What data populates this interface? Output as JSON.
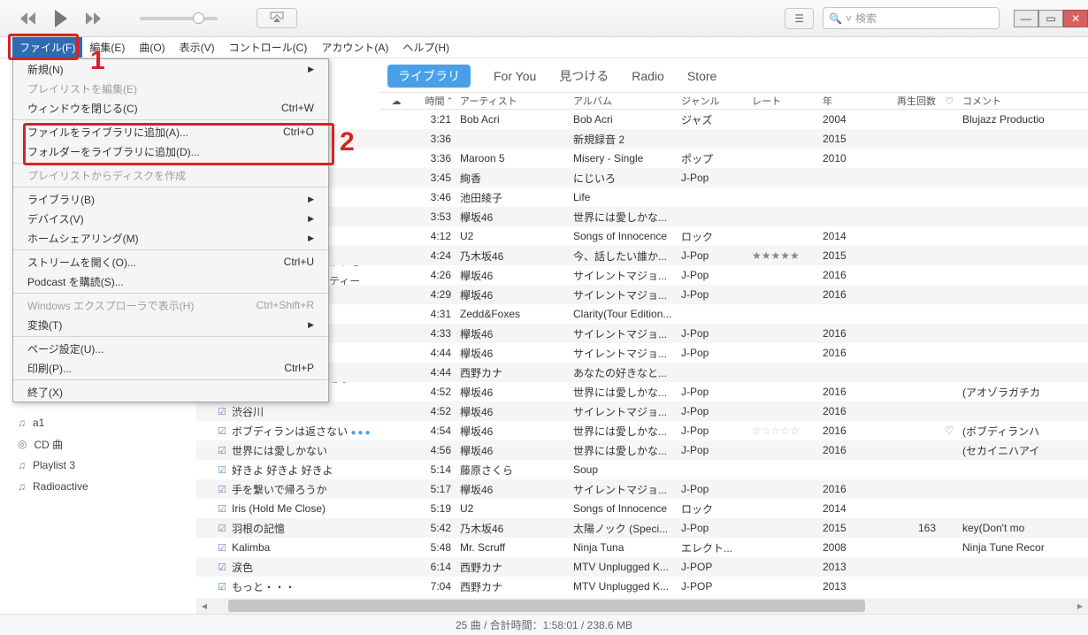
{
  "search_placeholder": "検索",
  "menubar": [
    "ファイル(F)",
    "編集(E)",
    "曲(O)",
    "表示(V)",
    "コントロール(C)",
    "アカウント(A)",
    "ヘルプ(H)"
  ],
  "file_menu": [
    {
      "label": "新規(N)",
      "shortcut": "",
      "arrow": true
    },
    {
      "label": "プレイリストを編集(E)",
      "disabled": true
    },
    {
      "label": "ウィンドウを閉じる(C)",
      "shortcut": "Ctrl+W"
    },
    {
      "sep": true
    },
    {
      "label": "ファイルをライブラリに追加(A)...",
      "shortcut": "Ctrl+O"
    },
    {
      "label": "フォルダーをライブラリに追加(D)..."
    },
    {
      "sep": true
    },
    {
      "label": "プレイリストからディスクを作成",
      "disabled": true
    },
    {
      "sep": true
    },
    {
      "label": "ライブラリ(B)",
      "arrow": true
    },
    {
      "label": "デバイス(V)",
      "arrow": true
    },
    {
      "label": "ホームシェアリング(M)",
      "arrow": true
    },
    {
      "sep": true
    },
    {
      "label": "ストリームを開く(O)...",
      "shortcut": "Ctrl+U"
    },
    {
      "label": "Podcast を購読(S)..."
    },
    {
      "sep": true
    },
    {
      "label": "Windows エクスプローラで表示(H)",
      "shortcut": "Ctrl+Shift+R",
      "disabled": true
    },
    {
      "label": "変換(T)",
      "arrow": true
    },
    {
      "sep": true
    },
    {
      "label": "ページ設定(U)..."
    },
    {
      "label": "印刷(P)...",
      "shortcut": "Ctrl+P"
    },
    {
      "sep": true
    },
    {
      "label": "終了(X)"
    }
  ],
  "annotation_1": "1",
  "annotation_2": "2",
  "nav": {
    "library": "ライブラリ",
    "foryou": "For You",
    "browse": "見つける",
    "radio": "Radio",
    "store": "Store"
  },
  "columns": {
    "cloud": "",
    "time": "時間",
    "artist": "アーティスト",
    "album": "アルバム",
    "genre": "ジャンル",
    "rate": "レート",
    "year": "年",
    "plays": "再生回数",
    "heart": "♡",
    "comment": "コメント"
  },
  "sort_arrow": "⌃",
  "peek1": "がいる",
  "peek2": "ティー",
  "peek3": "こう",
  "tracks": [
    {
      "name": "",
      "time": "3:21",
      "artist": "Bob Acri",
      "album": "Bob Acri",
      "genre": "ジャズ",
      "year": "2004",
      "comment": "Blujazz Productio"
    },
    {
      "name": "",
      "time": "3:36",
      "artist": "",
      "album": "新規録音 2",
      "genre": "",
      "year": "2015"
    },
    {
      "name": "",
      "time": "3:36",
      "artist": "Maroon 5",
      "album": "Misery - Single",
      "genre": "ポップ",
      "year": "2010"
    },
    {
      "name": "",
      "time": "3:45",
      "artist": "絢香",
      "album": "にじいろ",
      "genre": "J-Pop"
    },
    {
      "name": "",
      "time": "3:46",
      "artist": "池田綾子",
      "album": "Life"
    },
    {
      "name": "",
      "time": "3:53",
      "artist": "欅坂46",
      "album": "世界には愛しかな..."
    },
    {
      "name": "",
      "time": "4:12",
      "artist": "U2",
      "album": "Songs of Innocence",
      "genre": "ロック",
      "year": "2014"
    },
    {
      "name": "",
      "time": "4:24",
      "artist": "乃木坂46",
      "album": "今、話したい誰か...",
      "genre": "J-Pop",
      "rate": "★★★★★",
      "year": "2015"
    },
    {
      "name": "",
      "time": "4:26",
      "artist": "欅坂46",
      "album": "サイレントマジョ...",
      "genre": "J-Pop",
      "year": "2016"
    },
    {
      "name": "",
      "time": "4:29",
      "artist": "欅坂46",
      "album": "サイレントマジョ...",
      "genre": "J-Pop",
      "year": "2016"
    },
    {
      "name": "",
      "time": "4:31",
      "artist": "Zedd&Foxes",
      "album": "Clarity(Tour Edition..."
    },
    {
      "name": "",
      "time": "4:33",
      "artist": "欅坂46",
      "album": "サイレントマジョ...",
      "genre": "J-Pop",
      "year": "2016"
    },
    {
      "name": "",
      "time": "4:44",
      "artist": "欅坂46",
      "album": "サイレントマジョ...",
      "genre": "J-Pop",
      "year": "2016"
    },
    {
      "name": "",
      "time": "4:44",
      "artist": "西野カナ",
      "album": "あなたの好きなと..."
    },
    {
      "name": "",
      "time": "4:52",
      "artist": "欅坂46",
      "album": "世界には愛しかな...",
      "genre": "J-Pop",
      "year": "2016",
      "comment": "(アオゾラガチカ"
    },
    {
      "name": "渋谷川",
      "chk": true,
      "time": "4:52",
      "artist": "欅坂46",
      "album": "サイレントマジョ...",
      "genre": "J-Pop",
      "year": "2016"
    },
    {
      "name": "ボブディランは返さない",
      "chk": true,
      "dots": true,
      "time": "4:54",
      "artist": "欅坂46",
      "album": "世界には愛しかな...",
      "genre": "J-Pop",
      "rate": "☆☆☆☆☆",
      "rate_empty": true,
      "year": "2016",
      "heart": "♡",
      "comment": "(ボブディランハ"
    },
    {
      "name": "世界には愛しかない",
      "chk": true,
      "time": "4:56",
      "artist": "欅坂46",
      "album": "世界には愛しかな...",
      "genre": "J-Pop",
      "year": "2016",
      "comment": "(セカイニハアイ"
    },
    {
      "name": "好きよ 好きよ 好きよ",
      "chk": true,
      "time": "5:14",
      "artist": "藤原さくら",
      "album": "Soup"
    },
    {
      "name": "手を繋いで帰ろうか",
      "chk": true,
      "time": "5:17",
      "artist": "欅坂46",
      "album": "サイレントマジョ...",
      "genre": "J-Pop",
      "year": "2016"
    },
    {
      "name": "Iris (Hold Me Close)",
      "chk": true,
      "time": "5:19",
      "artist": "U2",
      "album": "Songs of Innocence",
      "genre": "ロック",
      "year": "2014"
    },
    {
      "name": "羽根の記憶",
      "chk": true,
      "time": "5:42",
      "artist": "乃木坂46",
      "album": "太陽ノック (Speci...",
      "genre": "J-Pop",
      "year": "2015",
      "plays": "163",
      "comment": "key(Don't mo"
    },
    {
      "name": "Kalimba",
      "chk": true,
      "time": "5:48",
      "artist": "Mr. Scruff",
      "album": "Ninja Tuna",
      "genre": "エレクト...",
      "year": "2008",
      "comment": "Ninja Tune Recor"
    },
    {
      "name": "涙色",
      "chk": true,
      "time": "6:14",
      "artist": "西野カナ",
      "album": "MTV Unplugged K...",
      "genre": "J-POP",
      "year": "2013"
    },
    {
      "name": "もっと・・・",
      "chk": true,
      "time": "7:04",
      "artist": "西野カナ",
      "album": "MTV Unplugged K...",
      "genre": "J-POP",
      "year": "2013"
    }
  ],
  "playlists": [
    {
      "icon": "♫",
      "label": "a1"
    },
    {
      "icon": "◎",
      "label": "CD 曲"
    },
    {
      "icon": "♫",
      "label": "Playlist 3"
    },
    {
      "icon": "♫",
      "label": "Radioactive"
    }
  ],
  "status": "25 曲 / 合計時間：1:58:01 / 238.6 MB"
}
